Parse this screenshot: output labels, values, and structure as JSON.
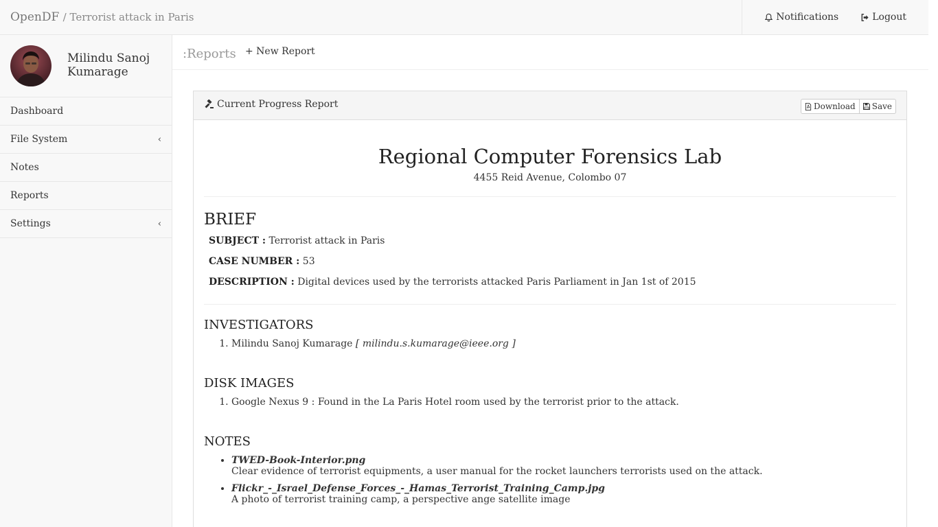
{
  "header": {
    "brand": "OpenDF",
    "case_title": "Terrorist attack in Paris",
    "notifications_label": "Notifications",
    "logout_label": "Logout"
  },
  "user": {
    "name": "Milindu Sanoj Kumarage"
  },
  "sidebar": {
    "items": [
      {
        "label": "Dashboard",
        "has_chevron": false
      },
      {
        "label": "File System",
        "has_chevron": true
      },
      {
        "label": "Notes",
        "has_chevron": false
      },
      {
        "label": "Reports",
        "has_chevron": false
      },
      {
        "label": "Settings",
        "has_chevron": true
      }
    ]
  },
  "subbar": {
    "title": ":Reports",
    "new_report_label": "+ New Report"
  },
  "panel": {
    "title": "Current Progress Report",
    "download_label": "Download",
    "save_label": "Save"
  },
  "report": {
    "lab_name": "Regional Computer Forensics Lab",
    "lab_address": "4455 Reid Avenue, Colombo 07",
    "brief_heading": "BRIEF",
    "subject_label": "SUBJECT :",
    "subject": "Terrorist attack in Paris",
    "case_number_label": "CASE NUMBER :",
    "case_number": "53",
    "description_label": "DESCRIPTION :",
    "description": "Digital devices used by the terrorists attacked Paris Parliament in Jan 1st of 2015",
    "investigators_heading": "INVESTIGATORS",
    "investigators": [
      {
        "name": "Milindu Sanoj Kumarage",
        "email": "[ milindu.s.kumarage@ieee.org ]"
      }
    ],
    "disk_images_heading": "DISK IMAGES",
    "disk_images": [
      "Google Nexus 9 : Found in the La Paris Hotel room used by the terrorist prior to the attack."
    ],
    "notes_heading": "NOTES",
    "notes": [
      {
        "file": "TWED-Book-Interior.png",
        "text": "Clear evidence of terrorist equipments, a user manual for the rocket launchers terrorists used on the attack."
      },
      {
        "file": "Flickr_-_Israel_Defense_Forces_-_Hamas_Terrorist_Training_Camp.jpg",
        "text": "A photo of terrorist training camp, a perspective ange satellite image"
      }
    ]
  },
  "icons": {
    "notifications": "bell-icon",
    "logout": "sign-out-icon",
    "panel": "gavel-icon",
    "download": "file-pdf-icon",
    "save": "floppy-disk-icon",
    "submenu": "chevron-left-icon"
  }
}
